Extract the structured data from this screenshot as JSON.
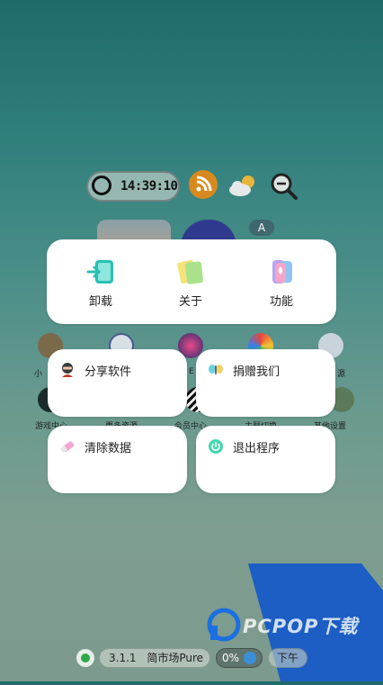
{
  "status_widget": {
    "time": "14:39:10"
  },
  "menu": {
    "top_items": [
      {
        "label": "卸载"
      },
      {
        "label": "关于"
      },
      {
        "label": "功能"
      }
    ],
    "cards": [
      {
        "label": "分享软件"
      },
      {
        "label": "捐赠我们"
      },
      {
        "label": "清除数据"
      },
      {
        "label": "退出程序"
      }
    ]
  },
  "background": {
    "row1_labels": [
      "小",
      "E",
      "",
      "",
      "源"
    ],
    "row2_labels": [
      "游戏中心",
      "更多资源",
      "会员中心",
      "主题切换",
      "其他设置"
    ]
  },
  "bottom_bar": {
    "version": "3.1.1",
    "app_name": "简市场Pure",
    "percent": "0%",
    "period": "下午"
  },
  "watermark": {
    "text": "PCPOP下载"
  },
  "colors": {
    "accent_teal": "#2bbfb3",
    "watermark_blue": "#1359c8"
  }
}
